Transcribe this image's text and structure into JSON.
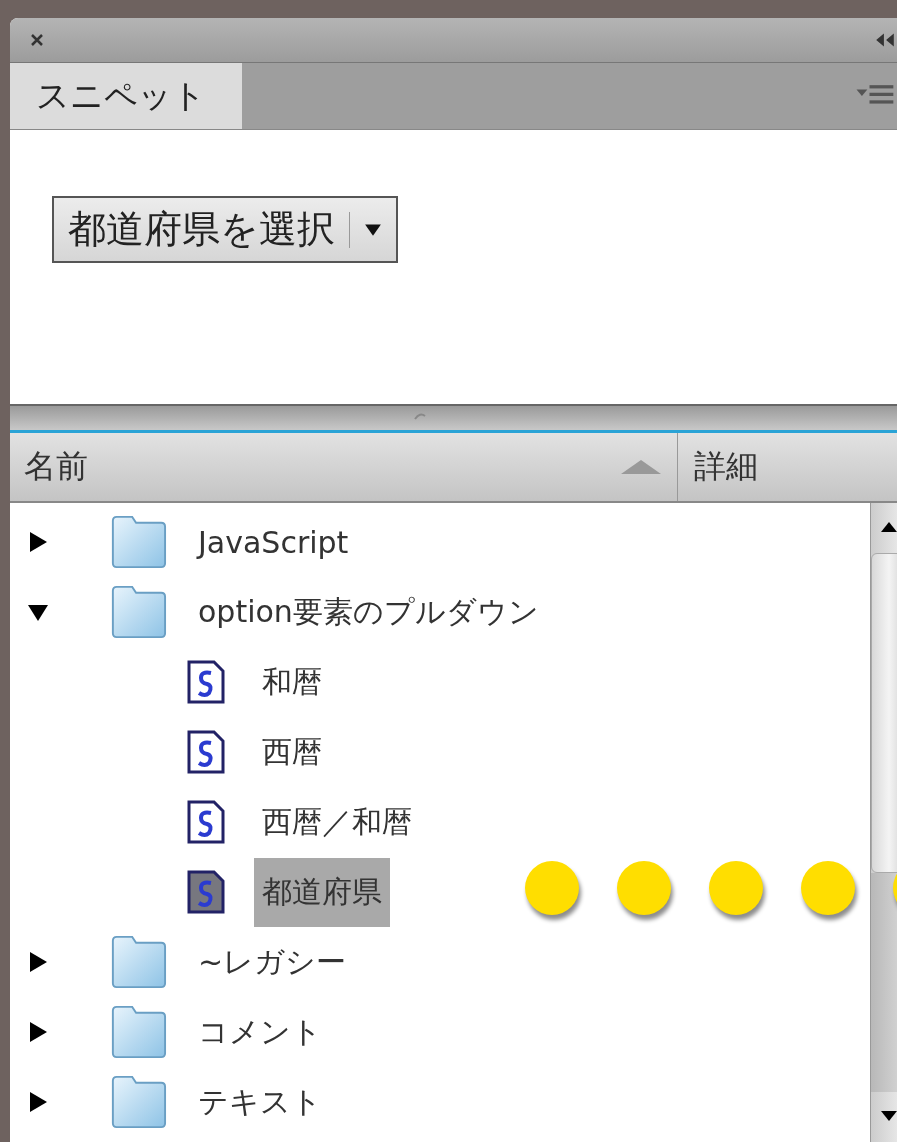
{
  "panel": {
    "tab": {
      "label": "スニペット",
      "selected": true
    }
  },
  "preview": {
    "select": {
      "value": "都道府県を選択"
    }
  },
  "columns": [
    {
      "label": "名前",
      "sorted": true
    },
    {
      "label": "詳細",
      "sorted": false
    }
  ],
  "tree": [
    {
      "label": "JavaScript",
      "kind": "folder",
      "expanded": false
    },
    {
      "label": "option要素のプルダウン",
      "kind": "folder",
      "expanded": true,
      "children": [
        {
          "label": "和暦",
          "kind": "snippet",
          "selected": false
        },
        {
          "label": "西暦",
          "kind": "snippet",
          "selected": false
        },
        {
          "label": "西暦／和暦",
          "kind": "snippet",
          "selected": false
        },
        {
          "label": "都道府県",
          "kind": "snippet",
          "selected": true
        }
      ]
    },
    {
      "label": "~レガシー",
      "kind": "folder",
      "expanded": false
    },
    {
      "label": "コメント",
      "kind": "folder",
      "expanded": false
    },
    {
      "label": "テキスト",
      "kind": "folder",
      "expanded": false
    }
  ]
}
